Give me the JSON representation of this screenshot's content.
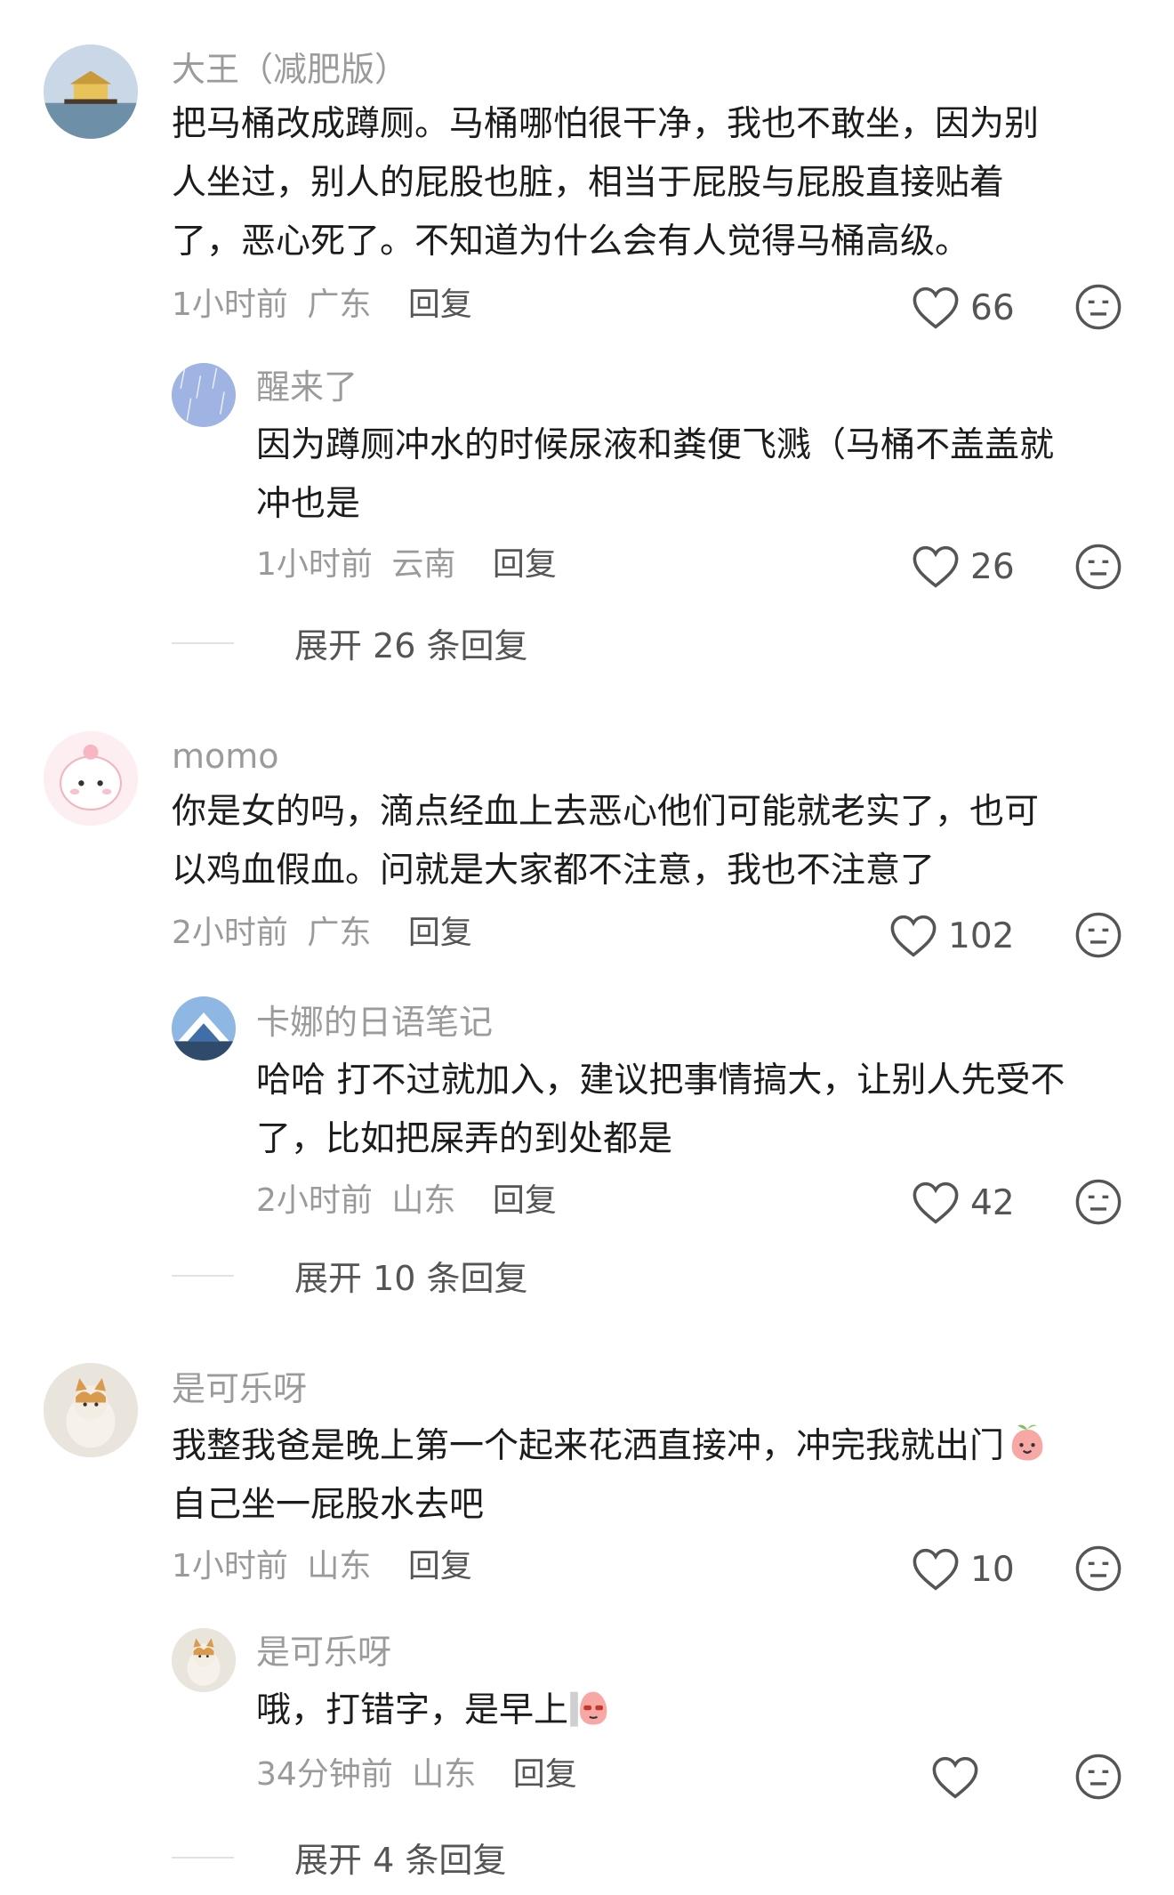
{
  "threads": [
    {
      "user": "大王（减肥版）",
      "text_lines": [
        "把马桶改成蹲厕。马桶哪怕很干净，我也不敢坐，因为别",
        "人坐过，别人的屁股也脏，相当于屁股与屁股直接贴着",
        "了，恶心死了。不知道为什么会有人觉得马桶高级。"
      ],
      "time": "1小时前",
      "location": "广东",
      "reply_label": "回复",
      "likes": "66",
      "reply": {
        "user": "醒来了",
        "text_lines": [
          "因为蹲厕冲水的时候尿液和粪便飞溅（马桶不盖盖就",
          "冲也是"
        ],
        "time": "1小时前",
        "location": "云南",
        "reply_label": "回复",
        "likes": "26"
      },
      "expand_label": "展开 26 条回复"
    },
    {
      "user": "momo",
      "text_lines": [
        "你是女的吗，滴点经血上去恶心他们可能就老实了，也可",
        "以鸡血假血。问就是大家都不注意，我也不注意了"
      ],
      "time": "2小时前",
      "location": "广东",
      "reply_label": "回复",
      "likes": "102",
      "reply": {
        "user": "卡娜的日语笔记",
        "text_lines": [
          "哈哈 打不过就加入，建议把事情搞大，让别人先受不",
          "了，比如把屎弄的到处都是"
        ],
        "time": "2小时前",
        "location": "山东",
        "reply_label": "回复",
        "likes": "42"
      },
      "expand_label": "展开 10 条回复"
    },
    {
      "user": "是可乐呀",
      "text_lines": [
        "我整我爸是晚上第一个起来花洒直接冲，冲完我就出门",
        "自己坐一屁股水去吧"
      ],
      "time": "1小时前",
      "location": "山东",
      "reply_label": "回复",
      "likes": "10",
      "reply": {
        "user": "是可乐呀",
        "text_lines": [
          "哦，打错字，是早上"
        ],
        "time": "34分钟前",
        "location": "山东",
        "reply_label": "回复",
        "likes": ""
      },
      "expand_label": "展开 4 条回复"
    }
  ],
  "icons": {
    "like": "heart-outline-icon",
    "dislike": "neutral-face-icon",
    "emoji_1": "peach-emoji",
    "emoji_2": "peach-sunglasses-emoji"
  },
  "colors": {
    "username": "#9b9b9b",
    "text": "#1c1c1c",
    "meta": "#9a9a9a",
    "icon_stroke": "#555555"
  }
}
